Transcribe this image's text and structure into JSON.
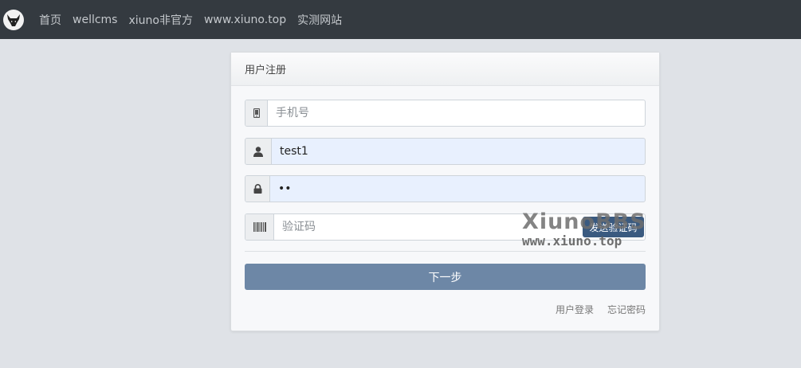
{
  "nav": {
    "logo_icon": "ox-head-logo-icon",
    "links": [
      "首页",
      "wellcms",
      "xiuno非官方",
      "www.xiuno.top",
      "实测网站"
    ]
  },
  "form": {
    "header": "用户注册",
    "phone": {
      "icon": "mobile-icon",
      "placeholder": "手机号",
      "value": ""
    },
    "username": {
      "icon": "user-icon",
      "value": "test1"
    },
    "password": {
      "icon": "lock-icon",
      "value": "••"
    },
    "code": {
      "icon": "barcode-icon",
      "placeholder": "验证码",
      "send_label": "发送验证码"
    },
    "submit_label": "下一步",
    "links": {
      "login": "用户登录",
      "forgot": "忘记密码"
    }
  },
  "watermark": {
    "line1": "XiunoBBS",
    "line2": "www.xiuno.top"
  },
  "colors": {
    "navbar": "#343a40",
    "submit": "#6d87a6",
    "send_button": "#3a5a80",
    "autofill": "#e8f0fe"
  }
}
